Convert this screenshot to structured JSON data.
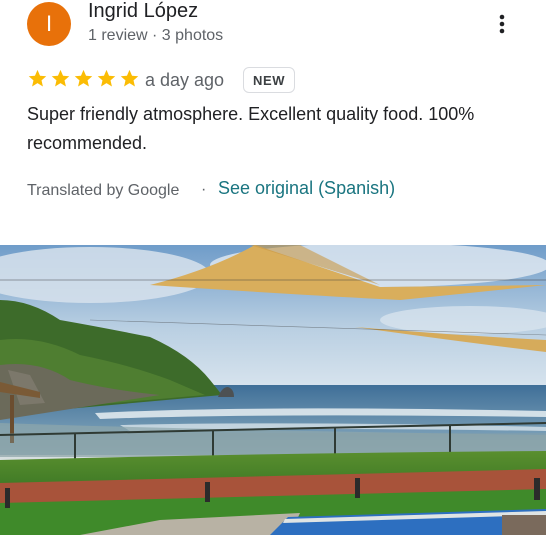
{
  "reviewer": {
    "initial": "I",
    "name": "Ingrid López",
    "meta": "1 review · 3 photos",
    "avatar_color": "#e8710a"
  },
  "rating": {
    "stars": 5,
    "star_color": "#fbbc04"
  },
  "time_ago": "a day ago",
  "badge": "NEW",
  "review_text": "Super friendly atmosphere. Excellent quality food. 100% recommended.",
  "translation": {
    "label": "Translated by Google",
    "separator": "·",
    "link": "See original (Spanish)",
    "link_color": "#1a7580"
  },
  "icons": {
    "menu": "more-vert-icon",
    "star": "star-icon"
  }
}
